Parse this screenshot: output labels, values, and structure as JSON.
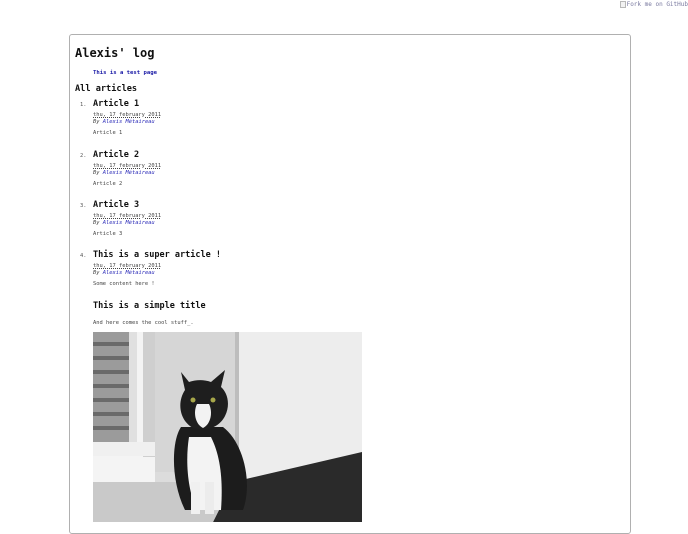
{
  "fork_banner": "Fork me on GitHub",
  "site": {
    "title": "Alexis' log",
    "page_link": "This is a test page"
  },
  "section_title": "All articles",
  "articles": [
    {
      "number": "1.",
      "title": "Article 1",
      "date": "thu, 17 february 2011",
      "by": "By",
      "author": "Alexis Métaireau",
      "summary_text": "Article ",
      "summary_link": "1"
    },
    {
      "number": "2.",
      "title": "Article 2",
      "date": "thu, 17 february 2011",
      "by": "By",
      "author": "Alexis Métaireau",
      "summary_text": "Article 2",
      "summary_link": ""
    },
    {
      "number": "3.",
      "title": "Article 3",
      "date": "thu, 17 february 2011",
      "by": "By",
      "author": "Alexis Métaireau",
      "summary_text": "Article 3",
      "summary_link": ""
    },
    {
      "number": "4.",
      "title": "This is a super article !",
      "date": "thu, 17 february 2011",
      "by": "By",
      "author": "Alexis Métaireau",
      "summary_text": "Some content here !",
      "summary_link": ""
    }
  ],
  "content": {
    "subtitle": "This is a simple title",
    "text": "And here comes the cool stuff_."
  },
  "colors": {
    "link": "#1a1aa6",
    "author": "#2a2ab8",
    "border": "#b0b0b0"
  }
}
